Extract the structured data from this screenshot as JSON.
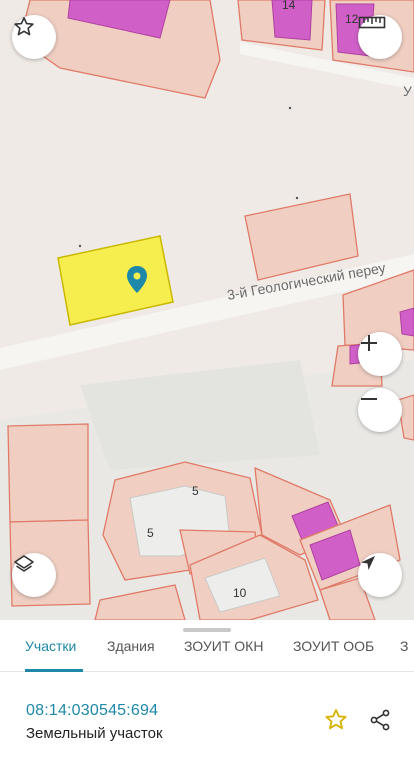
{
  "map": {
    "street_label": "3-й Геологический переу",
    "street_label_top": "У",
    "house_numbers": [
      "14",
      "12",
      "5",
      "5",
      "10"
    ],
    "colors": {
      "background": "#efeae6",
      "parcel_fill": "#f0cfc2",
      "parcel_stroke": "#e07a68",
      "building_fill": "#d060c8",
      "selected_fill": "#f5ee4e",
      "selected_stroke": "#c9b800",
      "marker": "#1e88a8"
    },
    "icons": {
      "favorite": "star-outline-icon",
      "ruler": "ruler-icon",
      "zoom_in": "plus-icon",
      "zoom_out": "minus-icon",
      "layers": "layers-icon",
      "location": "navigation-arrow-icon",
      "marker": "location-pin-icon"
    }
  },
  "tabs": [
    {
      "label": "Участки",
      "active": true
    },
    {
      "label": "Здания",
      "active": false
    },
    {
      "label": "ЗОУИТ ОКН",
      "active": false
    },
    {
      "label": "ЗОУИТ ООБ",
      "active": false
    },
    {
      "label": "З",
      "active": false
    }
  ],
  "parcel": {
    "cadastral_number": "08:14:030545:694",
    "type": "Земельный участок",
    "icons": {
      "favorite": "star-outline-icon",
      "share": "share-icon"
    },
    "accent_color": "#1e88a8",
    "favorite_color": "#d9b300"
  }
}
